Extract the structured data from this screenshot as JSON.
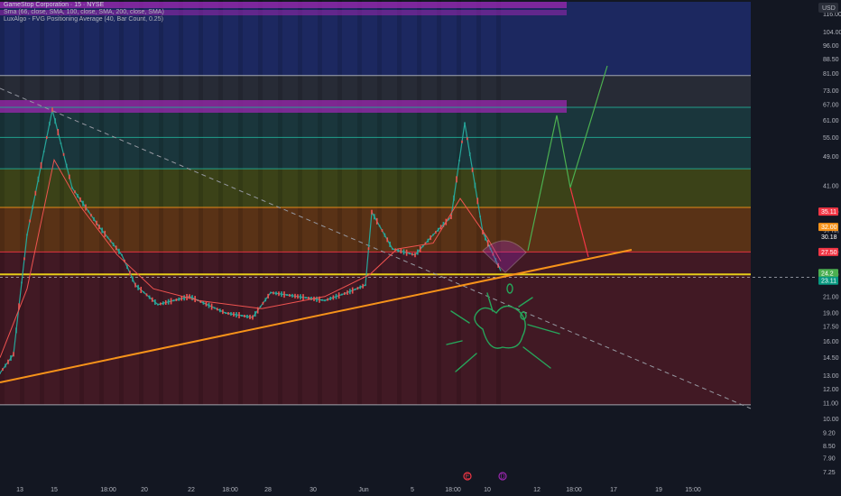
{
  "header": {
    "title": "GameStop Corporation · 15 · NYSE",
    "indicator_1": "Sma (66, close, SMA, 100, close, SMA, 200, close, SMA)",
    "indicator_2": "LuxAlgo - FVG Positioning Average (40, Bar Count, 0.25)"
  },
  "currency_button": "USD",
  "colors": {
    "background": "#131722",
    "price_zone_top": "#1e2c6b",
    "price_zone_upper": "#1c3a3f",
    "price_zone_mid": "#4a5216",
    "price_zone_lower": "#6b3a14",
    "price_zone_bottom": "#4a1a24",
    "trendline": "#f7931a",
    "projection_green": "#4caf50",
    "projection_red": "#f23645",
    "sketch_green": "#26a65b",
    "purple_band": "#9c27b0"
  },
  "chart_data": {
    "type": "candlestick",
    "symbol": "GME",
    "timeframe": "15",
    "y_scale": "log",
    "ylim": [
      7.0,
      125.0
    ],
    "y_ticks": [
      "116.00",
      "104.00",
      "96.00",
      "88.50",
      "81.00",
      "73.00",
      "67.00",
      "61.00",
      "55.00",
      "49.00",
      "41.00",
      "35.00",
      "31.00",
      "27.50",
      "24.00",
      "21.00",
      "19.00",
      "17.50",
      "16.00",
      "14.50",
      "13.00",
      "12.00",
      "11.00",
      "10.00",
      "9.20",
      "8.50",
      "7.90",
      "7.25"
    ],
    "x_ticks": [
      "13",
      "15",
      "18:00",
      "20",
      "22",
      "18:00",
      "28",
      "30",
      "Jun",
      "5",
      "18:00",
      "10",
      "12",
      "18:00",
      "17",
      "19",
      "15:00"
    ],
    "horizontal_levels": [
      80.0,
      66.0,
      55.0,
      45.5,
      36.0,
      27.5,
      24.0,
      10.9
    ],
    "price_tags": [
      {
        "label": "35.11",
        "price": 35.11,
        "color": "#f23645"
      },
      {
        "label": "32.00",
        "price": 32.0,
        "color": "#f7931a"
      },
      {
        "label": "30.18",
        "price": 30.18,
        "color": "#131722"
      },
      {
        "label": "27.50",
        "price": 27.5,
        "color": "#f23645"
      },
      {
        "label": "24.2",
        "price": 24.2,
        "color": "#4caf50"
      },
      {
        "label": "23.11",
        "price": 23.11,
        "color": "#089981"
      }
    ],
    "series": [
      {
        "name": "GME",
        "close": [
          13.2,
          14.8,
          30.5,
          65.0,
          40.5,
          32.0,
          27.0,
          22.5,
          20.0,
          21.0,
          19.0,
          18.5,
          21.5,
          21.0,
          20.5,
          21.5,
          22.5,
          35.0,
          28.0,
          27.0,
          30.5,
          34.0,
          60.0,
          31.0,
          24.5
        ]
      }
    ]
  },
  "event_markers": [
    {
      "label": "E",
      "color": "#f23645"
    },
    {
      "label": "D",
      "color": "#9c27b0"
    }
  ]
}
